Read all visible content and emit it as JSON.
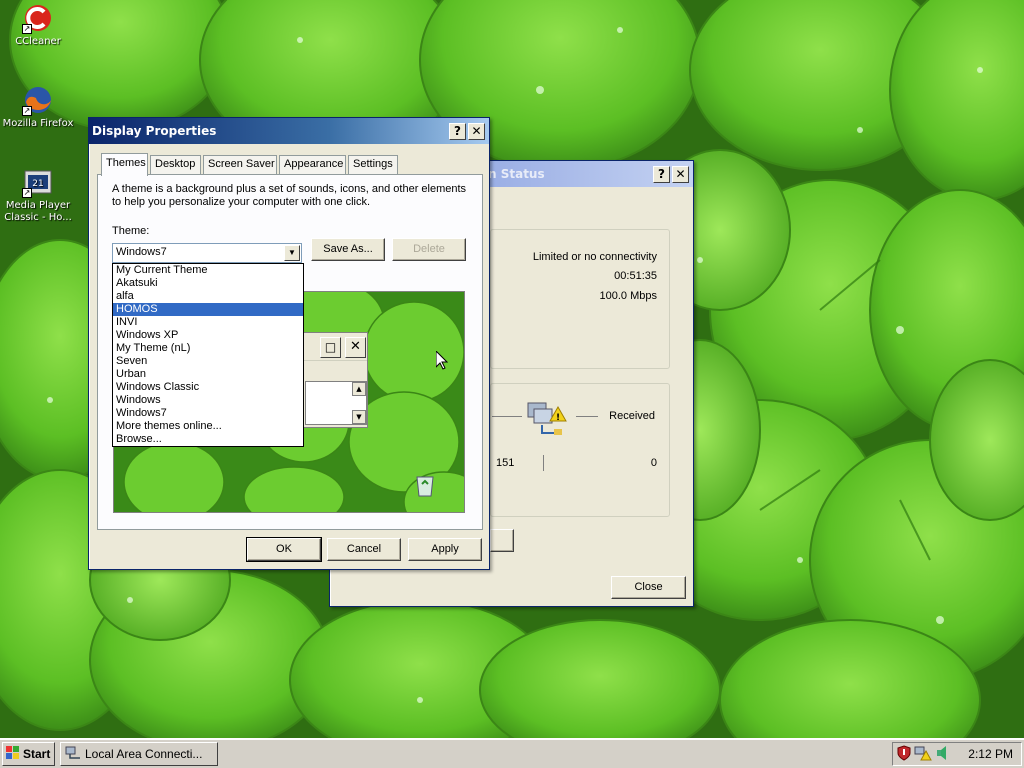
{
  "desktop": {
    "icons": [
      {
        "label": "CCleaner",
        "icon": "ccleaner-icon"
      },
      {
        "label": "Mozilla Firefox",
        "icon": "firefox-icon"
      },
      {
        "label": "Media Player Classic - Ho...",
        "icon": "media-player-icon"
      }
    ]
  },
  "status_window": {
    "title": "Local Area Connection Status",
    "title_visible": "n Status",
    "connectivity": "Limited or no connectivity",
    "duration": "00:51:35",
    "speed": "100.0 Mbps",
    "received_label": "Received",
    "sent_value": "151",
    "received_value": "0",
    "close_label": "Close",
    "help_glyph": "?",
    "close_glyph": "✕"
  },
  "display_window": {
    "title": "Display Properties",
    "help_glyph": "?",
    "close_glyph": "✕",
    "tabs": [
      "Themes",
      "Desktop",
      "Screen Saver",
      "Appearance",
      "Settings"
    ],
    "active_tab": "Themes",
    "description_line1": "A theme is a background plus a set of sounds, icons, and other elements",
    "description_line2": "to help you personalize your computer with one click.",
    "theme_label": "Theme:",
    "theme_selected": "Windows7",
    "save_as_label": "Save As...",
    "delete_label": "Delete",
    "theme_options": [
      "My Current Theme",
      "Akatsuki",
      "alfa",
      "HOMOS",
      "INVI",
      "Windows XP",
      "My Theme (nL)",
      "Seven",
      "Urban",
      "Windows Classic",
      "Windows",
      "Windows7",
      "More themes online...",
      "Browse..."
    ],
    "highlighted_option": "HOMOS",
    "ok_label": "OK",
    "cancel_label": "Cancel",
    "apply_label": "Apply"
  },
  "taskbar": {
    "start_label": "Start",
    "task_label": "Local Area Connecti...",
    "clock": "2:12 PM"
  },
  "colors": {
    "title_active": "#0a246a",
    "selection": "#316ac5",
    "face": "#ece9d8",
    "wallpaper": "#4f9e2c"
  }
}
